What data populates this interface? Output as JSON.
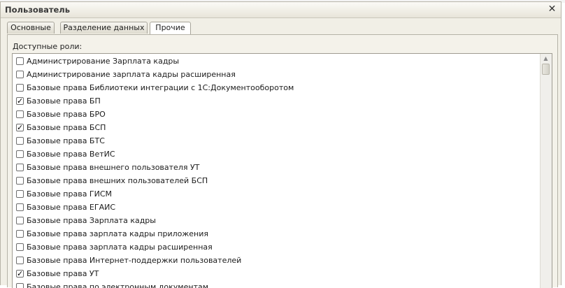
{
  "window": {
    "title": "Пользователь",
    "close_glyph": "✕"
  },
  "tabs": [
    {
      "label": "Основные",
      "active": false
    },
    {
      "label": "Разделение данных",
      "active": false
    },
    {
      "label": "Прочие",
      "active": true
    }
  ],
  "roles": {
    "label": "Доступные роли:",
    "items": [
      {
        "label": "Администрирование Зарплата кадры",
        "checked": false
      },
      {
        "label": "Администрирование зарплата кадры расширенная",
        "checked": false
      },
      {
        "label": "Базовые права Библиотеки интеграции с 1С:Документооборотом",
        "checked": false
      },
      {
        "label": "Базовые права БП",
        "checked": true
      },
      {
        "label": "Базовые права БРО",
        "checked": false
      },
      {
        "label": "Базовые права БСП",
        "checked": true
      },
      {
        "label": "Базовые права БТС",
        "checked": false
      },
      {
        "label": "Базовые права ВетИС",
        "checked": false
      },
      {
        "label": "Базовые права внешнего пользователя УТ",
        "checked": false
      },
      {
        "label": "Базовые права внешних пользователей БСП",
        "checked": false
      },
      {
        "label": "Базовые права ГИСМ",
        "checked": false
      },
      {
        "label": "Базовые права ЕГАИС",
        "checked": false
      },
      {
        "label": "Базовые права Зарплата кадры",
        "checked": false
      },
      {
        "label": "Базовые права зарплата кадры приложения",
        "checked": false
      },
      {
        "label": "Базовые права зарплата кадры расширенная",
        "checked": false
      },
      {
        "label": "Базовые права Интернет-поддержки пользователей",
        "checked": false
      },
      {
        "label": "Базовые права УТ",
        "checked": true
      },
      {
        "label": "Базовые права по электронным документам",
        "checked": false
      }
    ]
  },
  "icons": {
    "scroll_up": "▲",
    "check": "✓"
  }
}
